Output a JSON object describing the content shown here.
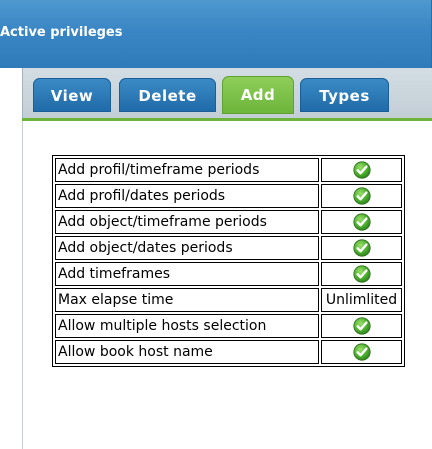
{
  "header": {
    "title": "Active privileges"
  },
  "tabs": [
    {
      "label": "View"
    },
    {
      "label": "Delete"
    },
    {
      "label": "Add"
    },
    {
      "label": "Types"
    }
  ],
  "active_tab": "Add",
  "privileges": [
    {
      "label": "Add profil/timeframe periods",
      "value": "",
      "icon": "check-icon"
    },
    {
      "label": "Add profil/dates periods",
      "value": "",
      "icon": "check-icon"
    },
    {
      "label": "Add object/timeframe periods",
      "value": "",
      "icon": "check-icon"
    },
    {
      "label": "Add object/dates periods",
      "value": "",
      "icon": "check-icon"
    },
    {
      "label": "Add timeframes",
      "value": "",
      "icon": "check-icon"
    },
    {
      "label": "Max elapse time",
      "value": "Unlimlited",
      "icon": ""
    },
    {
      "label": "Allow multiple hosts selection",
      "value": "",
      "icon": "check-icon"
    },
    {
      "label": "Allow book host name",
      "value": "",
      "icon": "check-icon"
    }
  ],
  "colors": {
    "header_blue": "#3a86c4",
    "tab_blue": "#1f6aa8",
    "tab_active_green": "#6cb43a",
    "check_green": "#4caf2f"
  }
}
